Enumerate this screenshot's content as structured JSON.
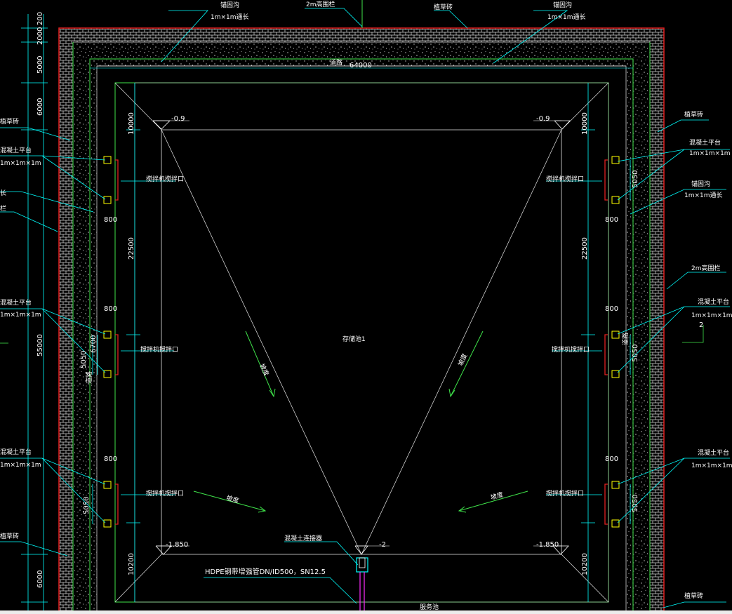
{
  "drawing": {
    "labels": {
      "anchor_trench_top": "锚固沟",
      "anchor_trench_top_size": "1m×1m通长",
      "fence_top": "2m高围栏",
      "grass_top": "植草砖",
      "anchor_trench_top_right": "锚固沟",
      "anchor_trench_top_right_size": "1m×1m通长",
      "road_top": "道路",
      "width_total": "64000",
      "left_grass": "植草砖",
      "left_platform": "混凝土平台",
      "left_platform_size": "1m×1m×1m",
      "left_length": "长",
      "left_fence": "栏",
      "right_grass": "植草砖",
      "right_platform": "混凝土平台",
      "right_platform_size": "1m×1m×1m",
      "right_anchor": "锚固沟",
      "right_anchor_size": "1m×1m通长",
      "right_fence": "2m高围栏",
      "section_mark": "2",
      "mixer_outlet": "搅拌机搅拌口",
      "level_top_left": "-0.9",
      "level_top_right": "-0.9",
      "level_bottom_left": "-1.850",
      "level_bottom_right": "-1.850",
      "level_center": "-2",
      "pond_name": "存储池1",
      "slope": "坡度",
      "connector": "混凝土连接器",
      "pipe": "HDPE钢带增强管DN/ID500，SN12.5",
      "service_road": "服务池",
      "bottom_grass_left": "植草砖",
      "bottom_grass_right": "植草砖"
    },
    "dimensions": {
      "d200": "200",
      "d2000": "2000",
      "d5000": "5000",
      "d6000_top": "6000",
      "d55000": "55000",
      "d6000_bottom": "6000",
      "d10000_top_left": "10000",
      "d22500_left": "22500",
      "d10200_left": "10200",
      "d10000_top_right": "10000",
      "d22500_right": "22500",
      "d10200_right": "10200",
      "d800_l1": "800",
      "d800_l2": "800",
      "d800_l3": "800",
      "d5050_l2": "5050",
      "d6700_l": "6700",
      "d5050_l3": "5050",
      "d800_r1": "800",
      "d800_r2": "800",
      "d800_r3": "800",
      "d5050_r1": "5050",
      "d5050_r2": "5050",
      "d5050_r3": "5050",
      "road_left": "道路",
      "road_right": "道路"
    },
    "colors": {
      "outer_red": "#e21f1f",
      "green_line": "#3fe34a",
      "cyan": "#00ffff",
      "white": "#ffffff",
      "yellow": "#ffff00",
      "magenta": "#ff2bff",
      "gravel": "#d0d0d0"
    }
  }
}
